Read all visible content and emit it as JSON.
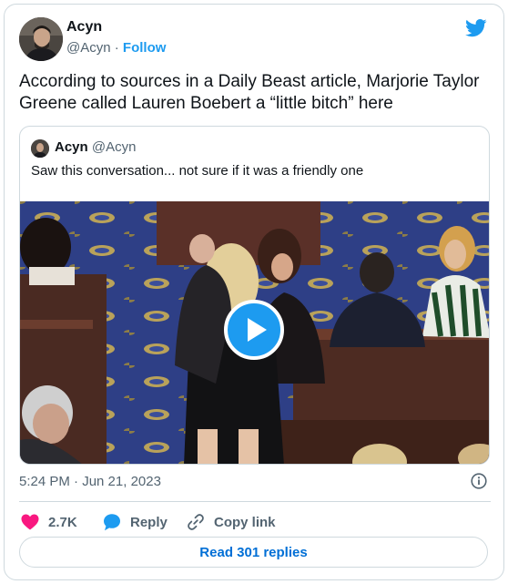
{
  "author": {
    "name": "Acyn",
    "handle": "@Acyn",
    "separator": "·",
    "follow_label": "Follow"
  },
  "tweet": {
    "text": "According to sources in a Daily Beast article, Marjorie Taylor Greene called Lauren Boebert a “little bitch” here",
    "timestamp": "5:24 PM · Jun 21, 2023"
  },
  "quoted": {
    "name": "Acyn",
    "handle": "@Acyn",
    "text": "Saw this conversation... not sure if it was a friendly one"
  },
  "actions": {
    "like_count": "2.7K",
    "reply_label": "Reply",
    "copy_label": "Copy link"
  },
  "read_replies_label": "Read 301 replies",
  "colors": {
    "accent": "#1d9bf0",
    "like": "#f91880",
    "link": "#006fd6",
    "muted": "#536471"
  },
  "icons": [
    "twitter-bird-icon",
    "play-icon",
    "info-icon",
    "heart-icon",
    "reply-bubble-icon",
    "link-icon"
  ]
}
